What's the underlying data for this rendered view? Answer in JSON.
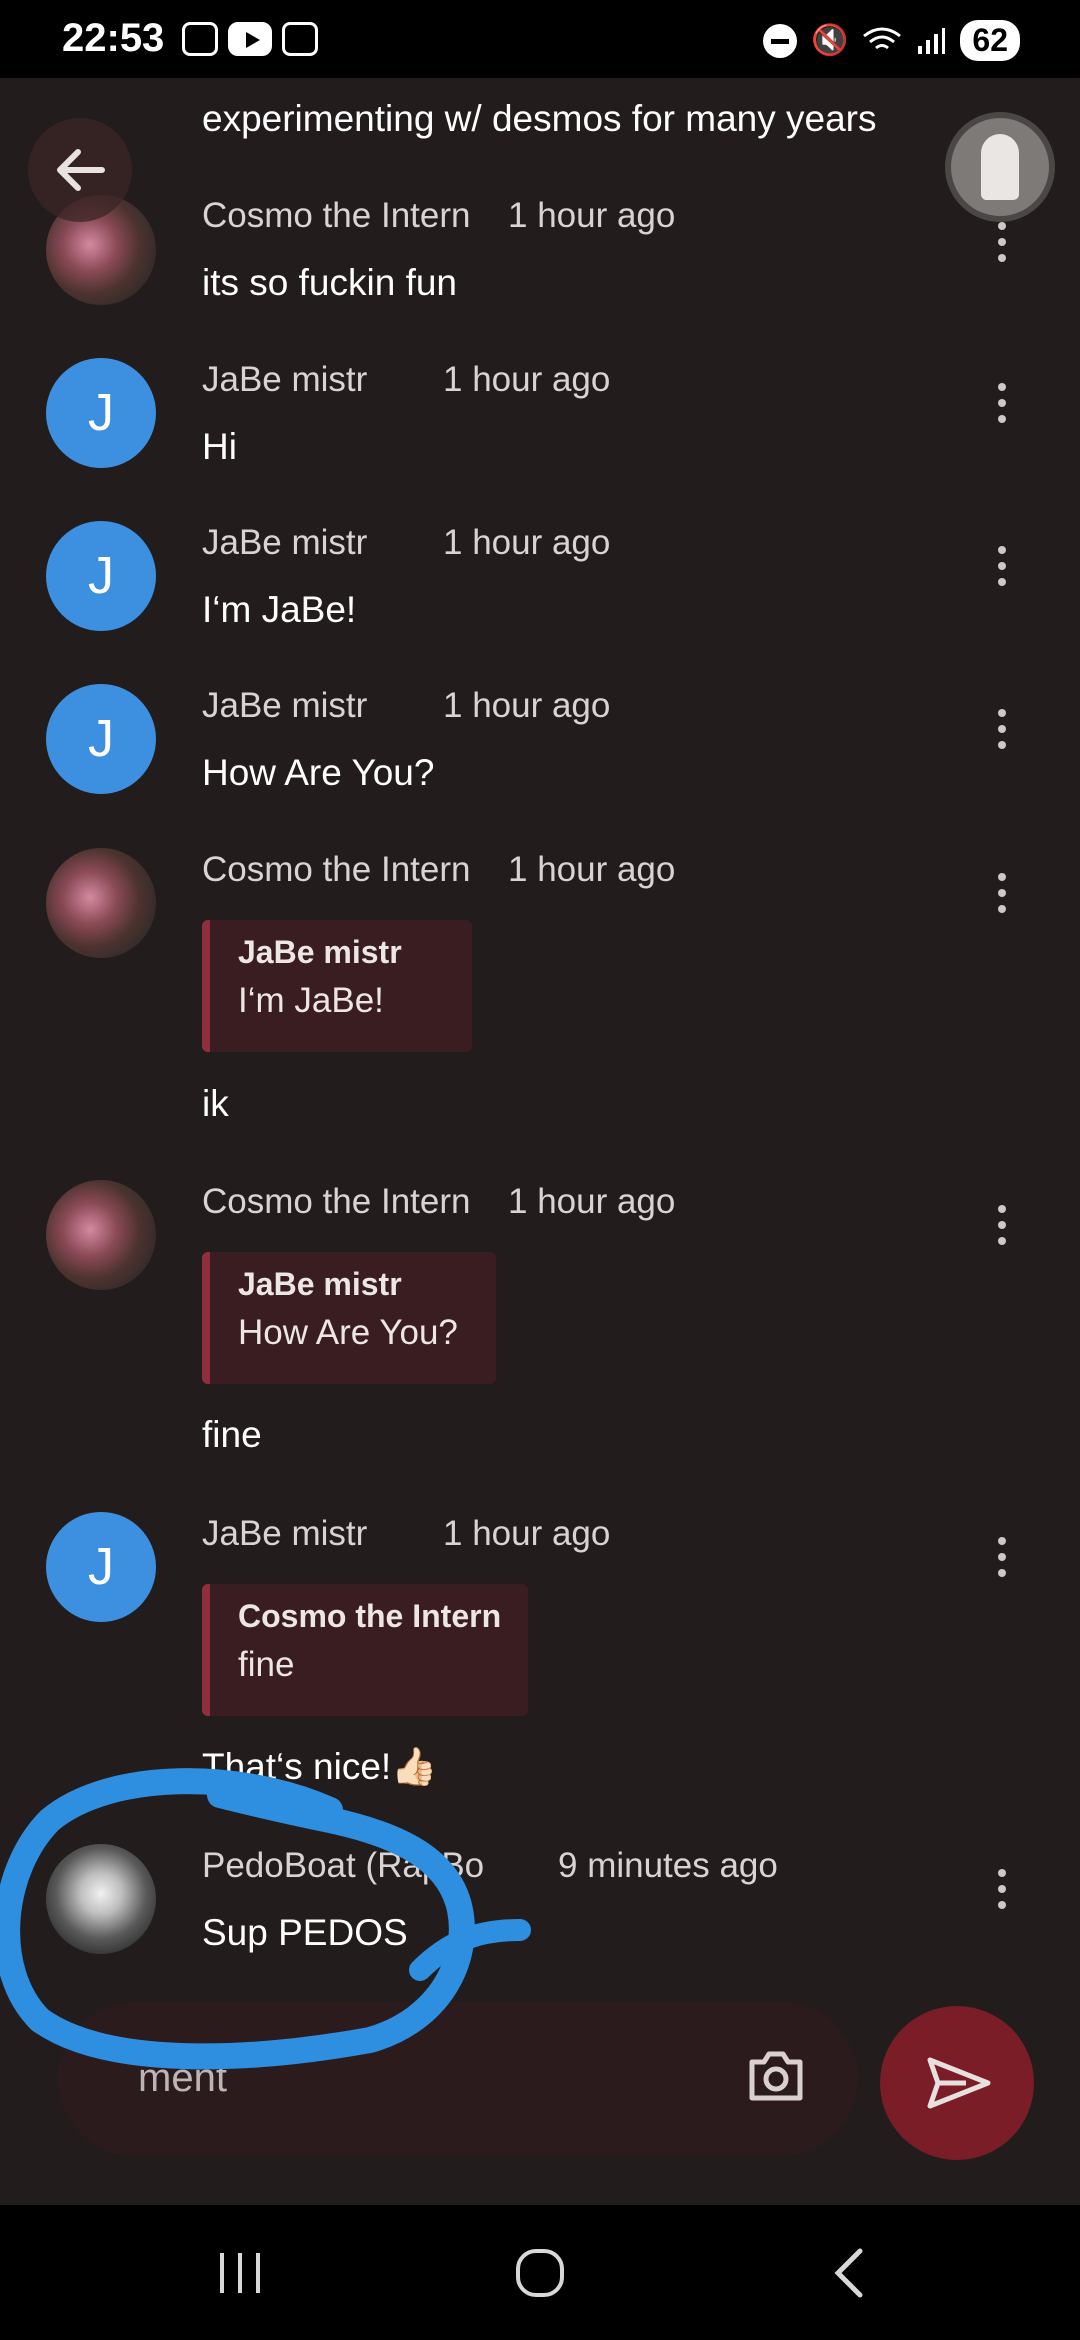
{
  "status_bar": {
    "time": "22:53",
    "battery": "62"
  },
  "partial_top_text": "experimenting w/ desmos for many years",
  "messages": [
    {
      "author": "Cosmo the Intern",
      "time": "1 hour ago",
      "text": "its so fuckin fun",
      "avatar": "cosmo"
    },
    {
      "author": "JaBe mistr",
      "time": "1 hour ago",
      "text": "Hi",
      "avatar_letter": "J"
    },
    {
      "author": "JaBe mistr",
      "time": "1 hour ago",
      "text": "I‘m JaBe!",
      "avatar_letter": "J"
    },
    {
      "author": "JaBe mistr",
      "time": "1 hour ago",
      "text": "How Are You?",
      "avatar_letter": "J"
    },
    {
      "author": "Cosmo the Intern",
      "time": "1 hour ago",
      "quote_author": "JaBe mistr",
      "quote_text": "I‘m JaBe!",
      "text": "ik",
      "avatar": "cosmo"
    },
    {
      "author": "Cosmo the Intern",
      "time": "1 hour ago",
      "quote_author": "JaBe mistr",
      "quote_text": "How Are You?",
      "text": "fine",
      "avatar": "cosmo"
    },
    {
      "author": "JaBe mistr",
      "time": "1 hour ago",
      "quote_author": "Cosmo the Intern",
      "quote_text": "fine",
      "text": "That‘s nice!👍🏻",
      "avatar_letter": "J"
    },
    {
      "author": "PedoBoat (RapBo",
      "time": "9 minutes ago",
      "text": "Sup PEDOS",
      "avatar": "pedo"
    }
  ],
  "input": {
    "placeholder": "ment"
  },
  "icons": {
    "back": "arrow-left-icon",
    "profile": "ghost-avatar",
    "more": "more-vert-icon",
    "camera": "camera-icon",
    "send": "send-icon",
    "nav_recents": "recents-icon",
    "nav_home": "home-icon",
    "nav_back": "back-icon"
  },
  "colors": {
    "background": "#221d1c",
    "avatar_blue": "#3d8fe0",
    "quote_bg": "#3a1d21",
    "quote_border": "#8f2f3b",
    "send_button": "#7a1d27",
    "scribble": "#2e8fe0"
  }
}
